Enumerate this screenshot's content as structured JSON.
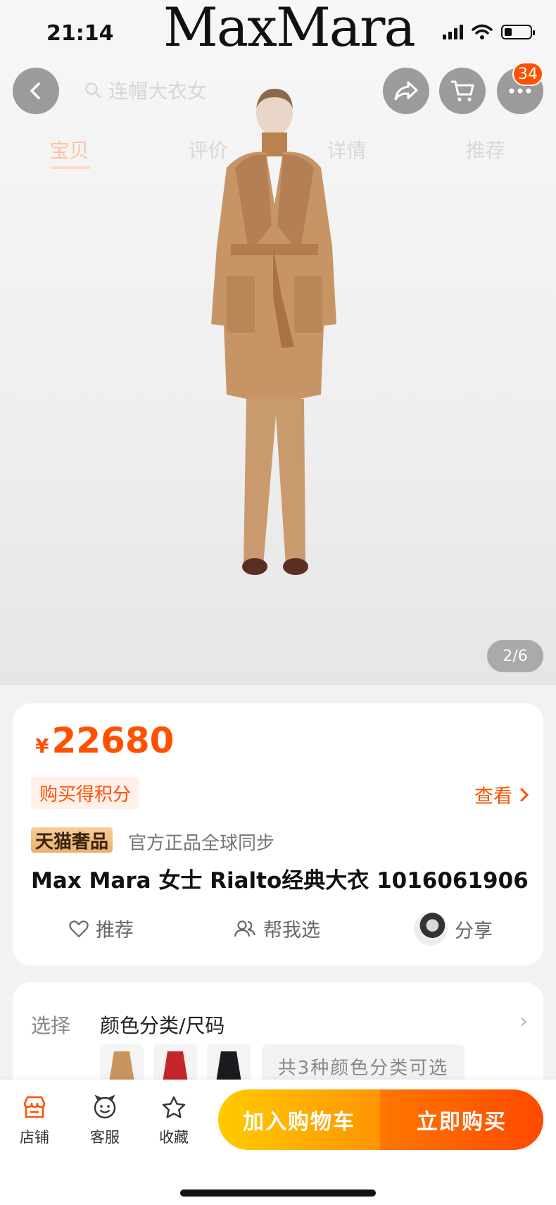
{
  "status": {
    "time": "21:14"
  },
  "brand": "MaxMara",
  "nav": {
    "search_placeholder": "连帽大衣女",
    "badge_count": "34",
    "tabs": [
      {
        "label": "宝贝",
        "active": true
      },
      {
        "label": "评价",
        "active": false
      },
      {
        "label": "详情",
        "active": false
      },
      {
        "label": "推荐",
        "active": false
      }
    ],
    "icons": [
      "back-icon",
      "share-icon",
      "cart-icon",
      "more-icon"
    ]
  },
  "gallery": {
    "counter": "2/6"
  },
  "product": {
    "price_symbol": "¥",
    "price": "22680",
    "points_tag": "购买得积分",
    "view_link": "查看",
    "tmall_tag": "天猫奢品",
    "tmall_note": "官方正品全球同步",
    "title": "Max Mara 女士 Rialto经典大衣 1016061906",
    "actions": {
      "recommend": "推荐",
      "help_choose": "帮我选",
      "share": "分享"
    }
  },
  "selection": {
    "label": "选择",
    "value": "颜色分类/尺码",
    "available": "共3种颜色分类可选",
    "swatch_colors": [
      "#c9945e",
      "#c4262b",
      "#1b1b1f"
    ]
  },
  "bottom": {
    "shop": "店铺",
    "service": "客服",
    "favorite": "收藏",
    "add_cart": "加入购物车",
    "buy_now": "立即购买"
  },
  "colors": {
    "accent": "#ff5000",
    "cart_start": "#ffcb00",
    "buy_end": "#ff4900"
  }
}
